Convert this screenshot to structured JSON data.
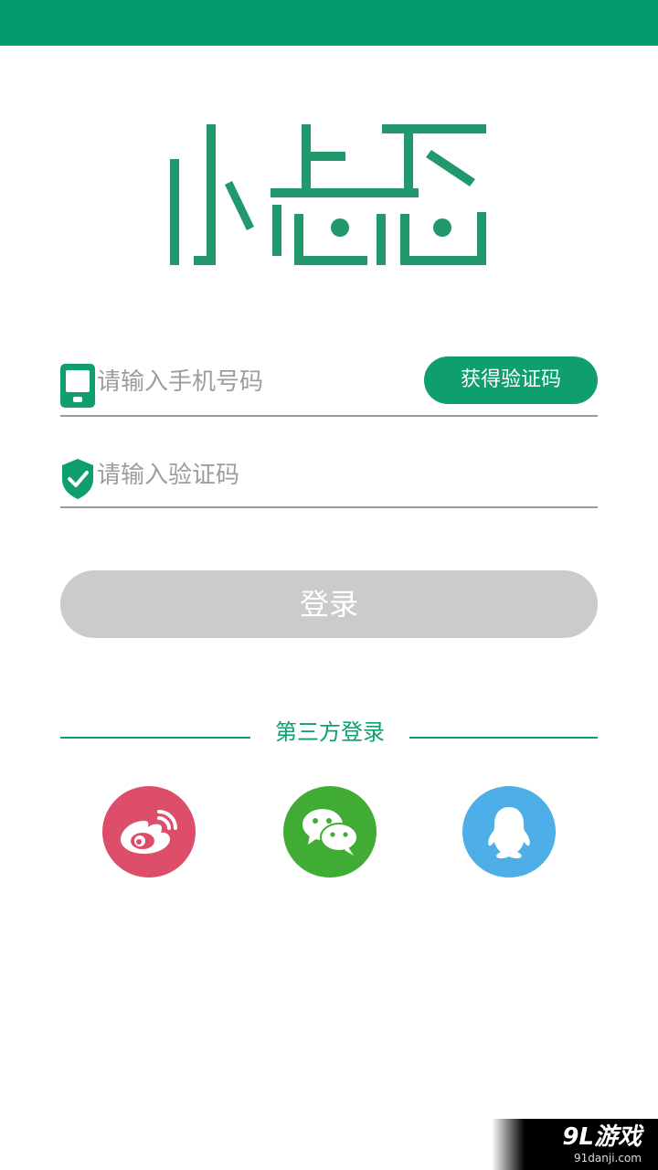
{
  "colors": {
    "accent": "#0e9e70",
    "status_bar": "#049c6f",
    "disabled_button": "#cbcbcb",
    "weibo": "#dd4e6a",
    "wechat": "#40ac34",
    "qq": "#4daee8"
  },
  "logo": {
    "text": "小志志",
    "icon": "brand-logo"
  },
  "phone_field": {
    "icon": "phone-icon",
    "placeholder": "请输入手机号码",
    "value": ""
  },
  "get_code_button": {
    "label": "获得验证码"
  },
  "code_field": {
    "icon": "shield-check-icon",
    "placeholder": "请输入验证码",
    "value": ""
  },
  "login_button": {
    "label": "登录"
  },
  "third_party": {
    "title": "第三方登录",
    "providers": [
      {
        "name": "weibo",
        "icon": "weibo-icon"
      },
      {
        "name": "wechat",
        "icon": "wechat-icon"
      },
      {
        "name": "qq",
        "icon": "qq-icon"
      }
    ]
  },
  "watermark": {
    "main": "9L游戏",
    "sub": "91danji.com"
  }
}
